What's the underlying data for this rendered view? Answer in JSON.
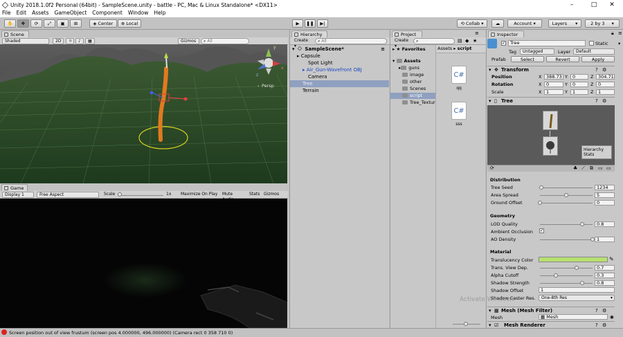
{
  "window": {
    "title": "Unity 2018.1.0f2 Personal (64bit) - SampleScene.unity - battle - PC, Mac & Linux Standalone* <DX11>",
    "controls": [
      "–",
      "□",
      "✕"
    ]
  },
  "menu": [
    "File",
    "Edit",
    "Assets",
    "GameObject",
    "Component",
    "Window",
    "Help"
  ],
  "toolbar": {
    "pivot": "Center",
    "space": "Local",
    "collab": "Collab ▾",
    "account": "Account ▾",
    "layers": "Layers",
    "layout": "2 by 3"
  },
  "scene": {
    "tab": "Scene",
    "shading": "Shaded",
    "mode2d": "2D",
    "gizmos": "Gizmos ▾",
    "search_placeholder": "All",
    "persp": "Persp",
    "gizmo_axes": [
      "y",
      "x",
      "z"
    ]
  },
  "game": {
    "tab": "Game",
    "display": "Display 1",
    "aspect": "Free Aspect",
    "scale_label": "Scale",
    "scale_value": "1x",
    "toggles": [
      "Maximize On Play",
      "Mute Audio",
      "Stats",
      "Gizmos ▾"
    ]
  },
  "hierarchy": {
    "tab": "Hierarchy",
    "create": "Create ▾",
    "search_placeholder": "All",
    "scene": "SampleScene*",
    "items": [
      {
        "label": "Capsule",
        "indent": 1,
        "arrow": "▸"
      },
      {
        "label": "Spot Light",
        "indent": 2
      },
      {
        "label": "Air_Gun-Wavefront OBJ",
        "indent": 2,
        "arrow": "▸",
        "prefab": true
      },
      {
        "label": "Camera",
        "indent": 2
      },
      {
        "label": "Tree",
        "indent": 1,
        "selected": true
      },
      {
        "label": "Terrain",
        "indent": 1
      }
    ]
  },
  "project": {
    "tab": "Project",
    "create": "Create ▾",
    "favorites": "Favorites",
    "breadcrumb": [
      "Assets",
      "script"
    ],
    "assets_root": "Assets",
    "folders": [
      "guns",
      "image",
      "other",
      "Scenes",
      "script",
      "Tree_Textures"
    ],
    "selected_folder": "script",
    "files": [
      {
        "name": "qq",
        "type": "C#"
      },
      {
        "name": "sss",
        "type": "C#"
      }
    ]
  },
  "inspector": {
    "tab": "Inspector",
    "object_name": "Tree",
    "static_label": "Static",
    "tag_label": "Tag",
    "tag_value": "Untagged",
    "layer_label": "Layer",
    "layer_value": "Default",
    "prefab_label": "Prefab",
    "prefab_buttons": [
      "Select",
      "Revert",
      "Apply"
    ],
    "transform": {
      "title": "Transform",
      "rows": [
        {
          "label": "Position",
          "x": "388.73",
          "y": "0",
          "z": "304.71"
        },
        {
          "label": "Rotation",
          "x": "0",
          "y": "0",
          "z": "0"
        },
        {
          "label": "Scale",
          "x": "1",
          "y": "1",
          "z": "1"
        }
      ]
    },
    "tree": {
      "title": "Tree",
      "hierarchy_stats": "Hierarchy Stats"
    },
    "distribution": {
      "title": "Distribution",
      "rows": [
        {
          "label": "Tree Seed",
          "value": "1234",
          "level": 0.03
        },
        {
          "label": "Area Spread",
          "value": "5",
          "level": 0.5
        },
        {
          "label": "Ground Offset",
          "value": "0",
          "level": 0.0
        }
      ]
    },
    "geometry": {
      "title": "Geometry",
      "lod_label": "LOD Quality",
      "lod_value": "0.8",
      "lod_level": 0.8,
      "ao_label": "Ambient Occlusion",
      "ao_checked": true,
      "ao_density_label": "AO Density",
      "ao_density_value": "1",
      "ao_density_level": 1.0
    },
    "material": {
      "title": "Material",
      "translucency_label": "Translucency Color",
      "translucency_color": "#b8e070",
      "rows": [
        {
          "label": "Trans. View Dep.",
          "value": "0.7",
          "level": 0.7
        },
        {
          "label": "Alpha Cutoff",
          "value": "0.3",
          "level": 0.3
        },
        {
          "label": "Shadow Strength",
          "value": "0.8",
          "level": 0.8
        }
      ],
      "shadow_offset_label": "Shadow Offset",
      "shadow_offset_value": "1",
      "shadow_caster_label": "Shadow Caster Res.",
      "shadow_caster_value": "One-8th Res"
    },
    "mesh_filter": {
      "title": "Mesh (Mesh Filter)",
      "mesh_label": "Mesh",
      "mesh_value": "Mesh"
    },
    "mesh_renderer": {
      "title": "Mesh Renderer"
    }
  },
  "watermark": "Activate Windows",
  "status": "Screen position out of view frustum (screen pos 4.000000, 496.000000) (Camera rect 0 358 710 0)"
}
